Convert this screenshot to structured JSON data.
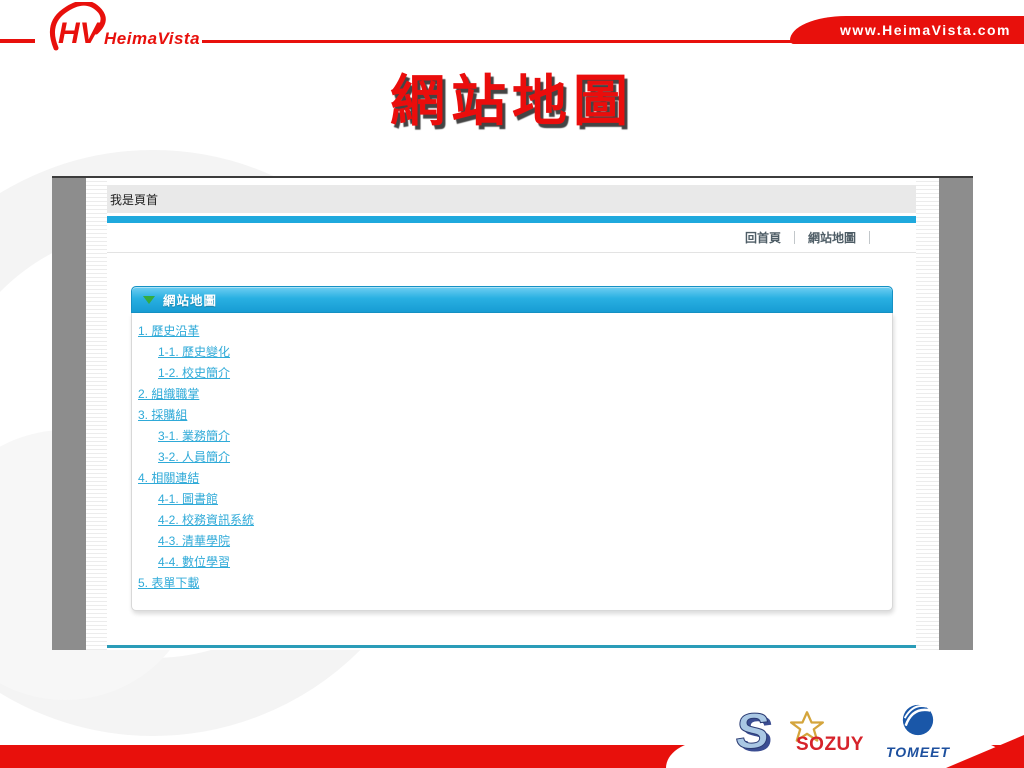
{
  "colors": {
    "brand_red": "#e8100c",
    "cyan_bar": "#1fa9dd",
    "link_blue": "#2faad8",
    "teal_line": "#2a9cb8",
    "arrow_green": "#35ab3f",
    "gray_strip": "#8d8d8d"
  },
  "header": {
    "logo_monogram": "HV",
    "logo_name": "HeimaVista",
    "url": "www.HeimaVista.com"
  },
  "slide_title": "網站地圖",
  "browser_page": {
    "header_bar_text": "我是頁首",
    "nav_links": [
      "回首頁",
      "網站地圖"
    ],
    "sitemap": {
      "panel_title": "網站地圖",
      "links": [
        {
          "label": "1. 歷史沿革",
          "level": 0
        },
        {
          "label": "1-1. 歷史變化",
          "level": 1
        },
        {
          "label": "1-2. 校史簡介",
          "level": 1
        },
        {
          "label": "2. 組織職掌",
          "level": 0
        },
        {
          "label": "3. 採購組",
          "level": 0
        },
        {
          "label": "3-1. 業務簡介",
          "level": 1
        },
        {
          "label": "3-2. 人員簡介",
          "level": 1
        },
        {
          "label": "4. 相關連結",
          "level": 0
        },
        {
          "label": "4-1. 圖書館",
          "level": 1
        },
        {
          "label": "4-2. 校務資訊系統",
          "level": 1
        },
        {
          "label": "4-3. 清華學院",
          "level": 1
        },
        {
          "label": "4-4. 數位學習",
          "level": 1
        },
        {
          "label": "5. 表單下載",
          "level": 0
        }
      ]
    }
  },
  "partner_logos": {
    "mascot_glyph": "S",
    "soquy_label": "SOZUY",
    "tomeet_label": "TOMEET"
  }
}
